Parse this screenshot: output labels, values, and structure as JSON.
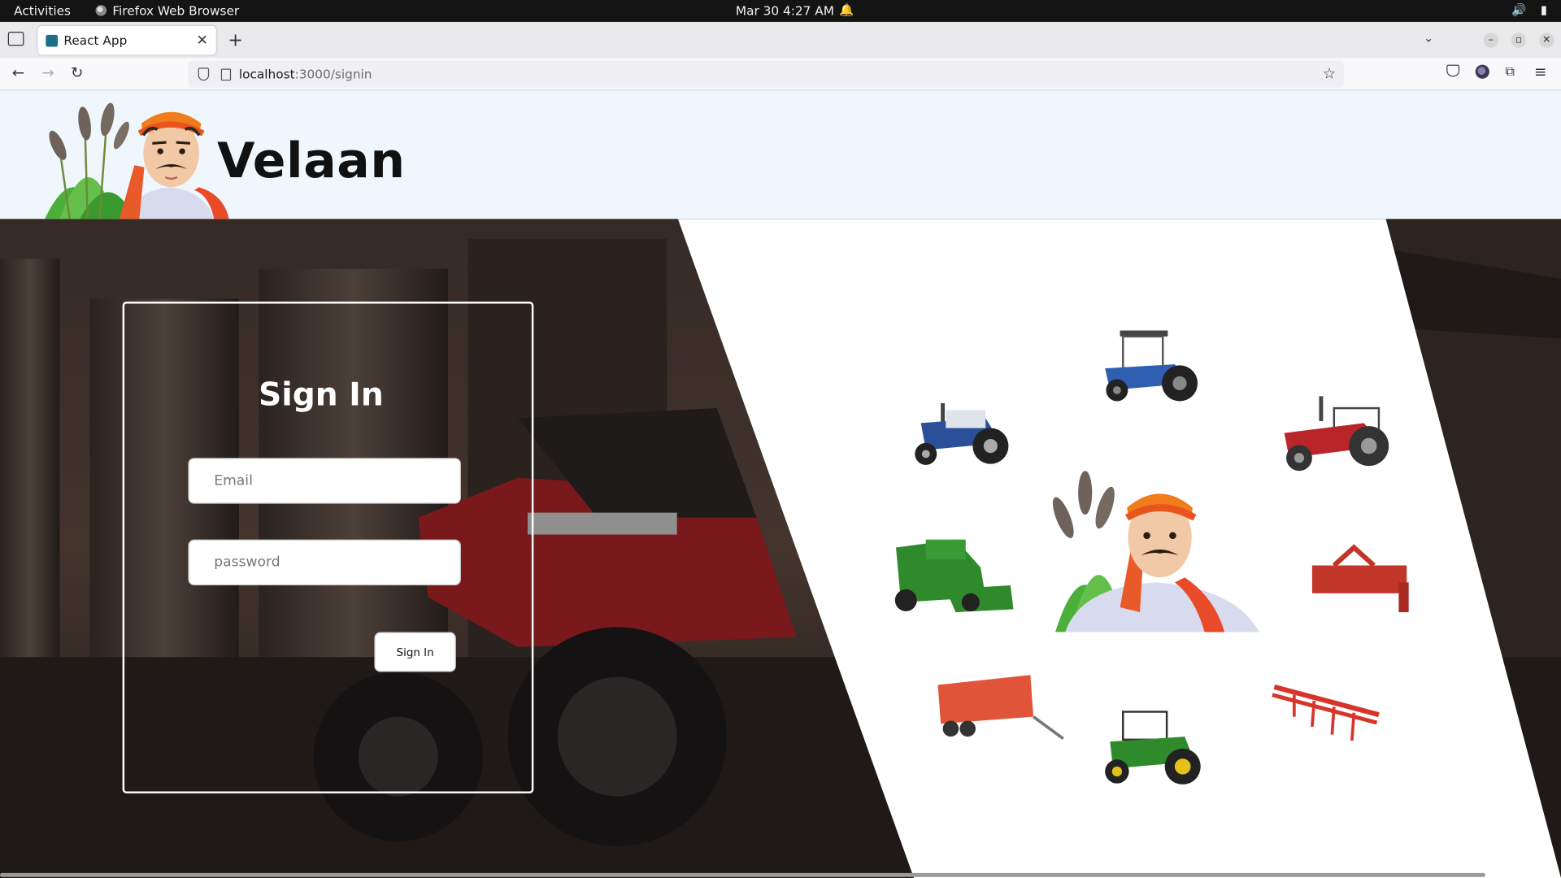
{
  "system_bar": {
    "activities": "Activities",
    "app_name": "Firefox Web Browser",
    "clock": "Mar 30  4:27 AM"
  },
  "browser": {
    "tab_title": "React App",
    "url_host": "localhost",
    "url_path": ":3000/signin"
  },
  "header": {
    "brand": "Velaan"
  },
  "signin": {
    "title": "Sign In",
    "email_placeholder": "Email",
    "password_placeholder": "password",
    "button_label": "Sign In"
  },
  "colors": {
    "header_bg": "#eff7fd",
    "panel_bg": "#ffffff",
    "turban": "#f07c1c",
    "tractor_red": "#b8262a",
    "tractor_green": "#2f8a2c"
  },
  "icons": [
    "firefox-icon",
    "bell-icon",
    "volume-icon",
    "battery-icon",
    "tab-list-icon",
    "close-icon",
    "plus-icon",
    "chevron-down-icon",
    "back-icon",
    "forward-icon",
    "reload-icon",
    "shield-icon",
    "page-icon",
    "star-icon",
    "pocket-icon",
    "account-icon",
    "extensions-icon",
    "menu-icon"
  ]
}
